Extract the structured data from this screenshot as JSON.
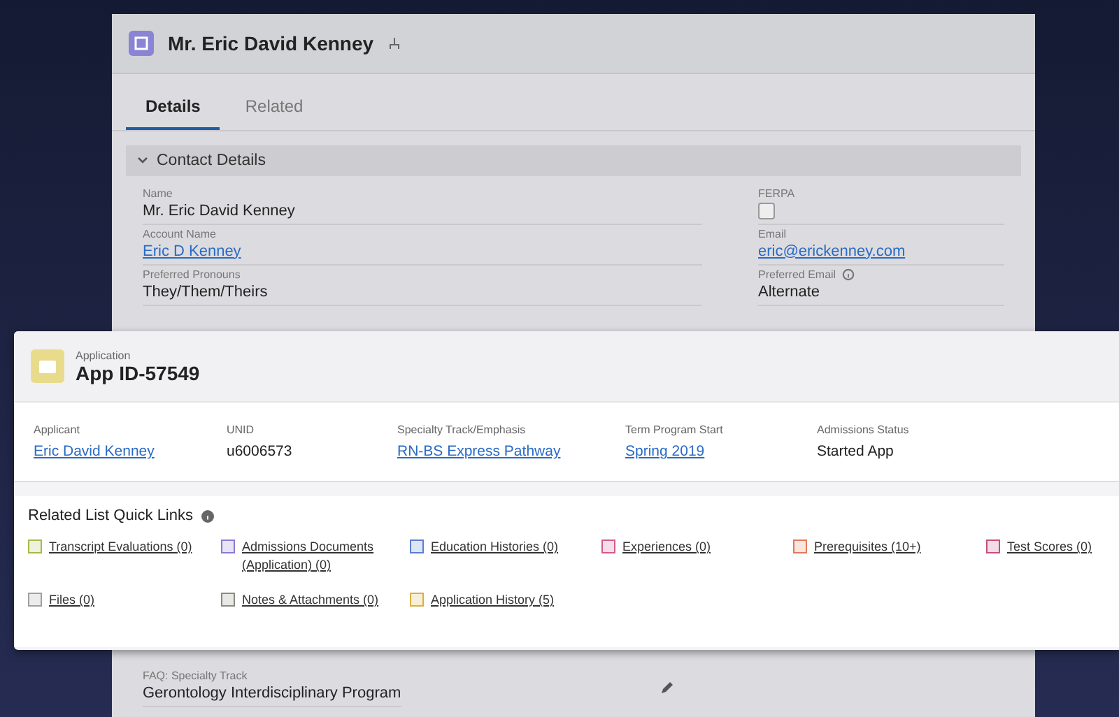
{
  "contact_record": {
    "title": "Mr. Eric David Kenney",
    "tabs": [
      {
        "label": "Details",
        "selected": true
      },
      {
        "label": "Related",
        "selected": false
      }
    ],
    "section": {
      "title": "Contact Details",
      "expanded": true
    },
    "fields": [
      {
        "label": "Name",
        "value": "Mr. Eric David Kenney",
        "kind": "text"
      },
      {
        "label": "FERPA",
        "checked": false,
        "kind": "checkbox"
      },
      {
        "label": "Account Name",
        "value": "Eric D Kenney",
        "kind": "link"
      },
      {
        "label": "Email",
        "value": "eric@erickenney.com",
        "kind": "link"
      },
      {
        "label": "Preferred Pronouns",
        "value": "They/Them/Theirs",
        "kind": "text"
      },
      {
        "label": "Preferred Email",
        "value": "Alternate",
        "kind": "text",
        "info": true
      }
    ],
    "lower_fields": [
      {
        "label": "FAQ: Specialty Track",
        "value": "Gerontology Interdisciplinary Program",
        "kind": "text"
      }
    ]
  },
  "application": {
    "object_label": "Application",
    "title": "App ID-57549",
    "highlights": [
      {
        "label": "Applicant",
        "value": "Eric David Kenney",
        "kind": "link"
      },
      {
        "label": "UNID",
        "value": "u6006573",
        "kind": "text"
      },
      {
        "label": "Specialty Track/Emphasis",
        "value": "RN-BS Express Pathway",
        "kind": "link"
      },
      {
        "label": "Term Program Start",
        "value": "Spring 2019",
        "kind": "link"
      },
      {
        "label": "Admissions Status",
        "value": "Started App",
        "kind": "text"
      }
    ],
    "quick_links": {
      "title": "Related List Quick Links",
      "links": [
        {
          "label": "Transcript Evaluations (0)",
          "color": "#a8b84c"
        },
        {
          "label": "Admissions Documents (Application) (0)",
          "color": "#8c7ad2"
        },
        {
          "label": "Education Histories (0)",
          "color": "#5a7fd2"
        },
        {
          "label": "Experiences (0)",
          "color": "#d25a8c"
        },
        {
          "label": "Prerequisites (10+)",
          "color": "#e07a5a"
        },
        {
          "label": "Test Scores (0)",
          "color": "#c2507c"
        },
        {
          "label": "Files (0)",
          "color": "#a0a0a0"
        },
        {
          "label": "Notes & Attachments (0)",
          "color": "#8a8a80"
        },
        {
          "label": "Application History (5)",
          "color": "#d8b040"
        }
      ]
    }
  }
}
